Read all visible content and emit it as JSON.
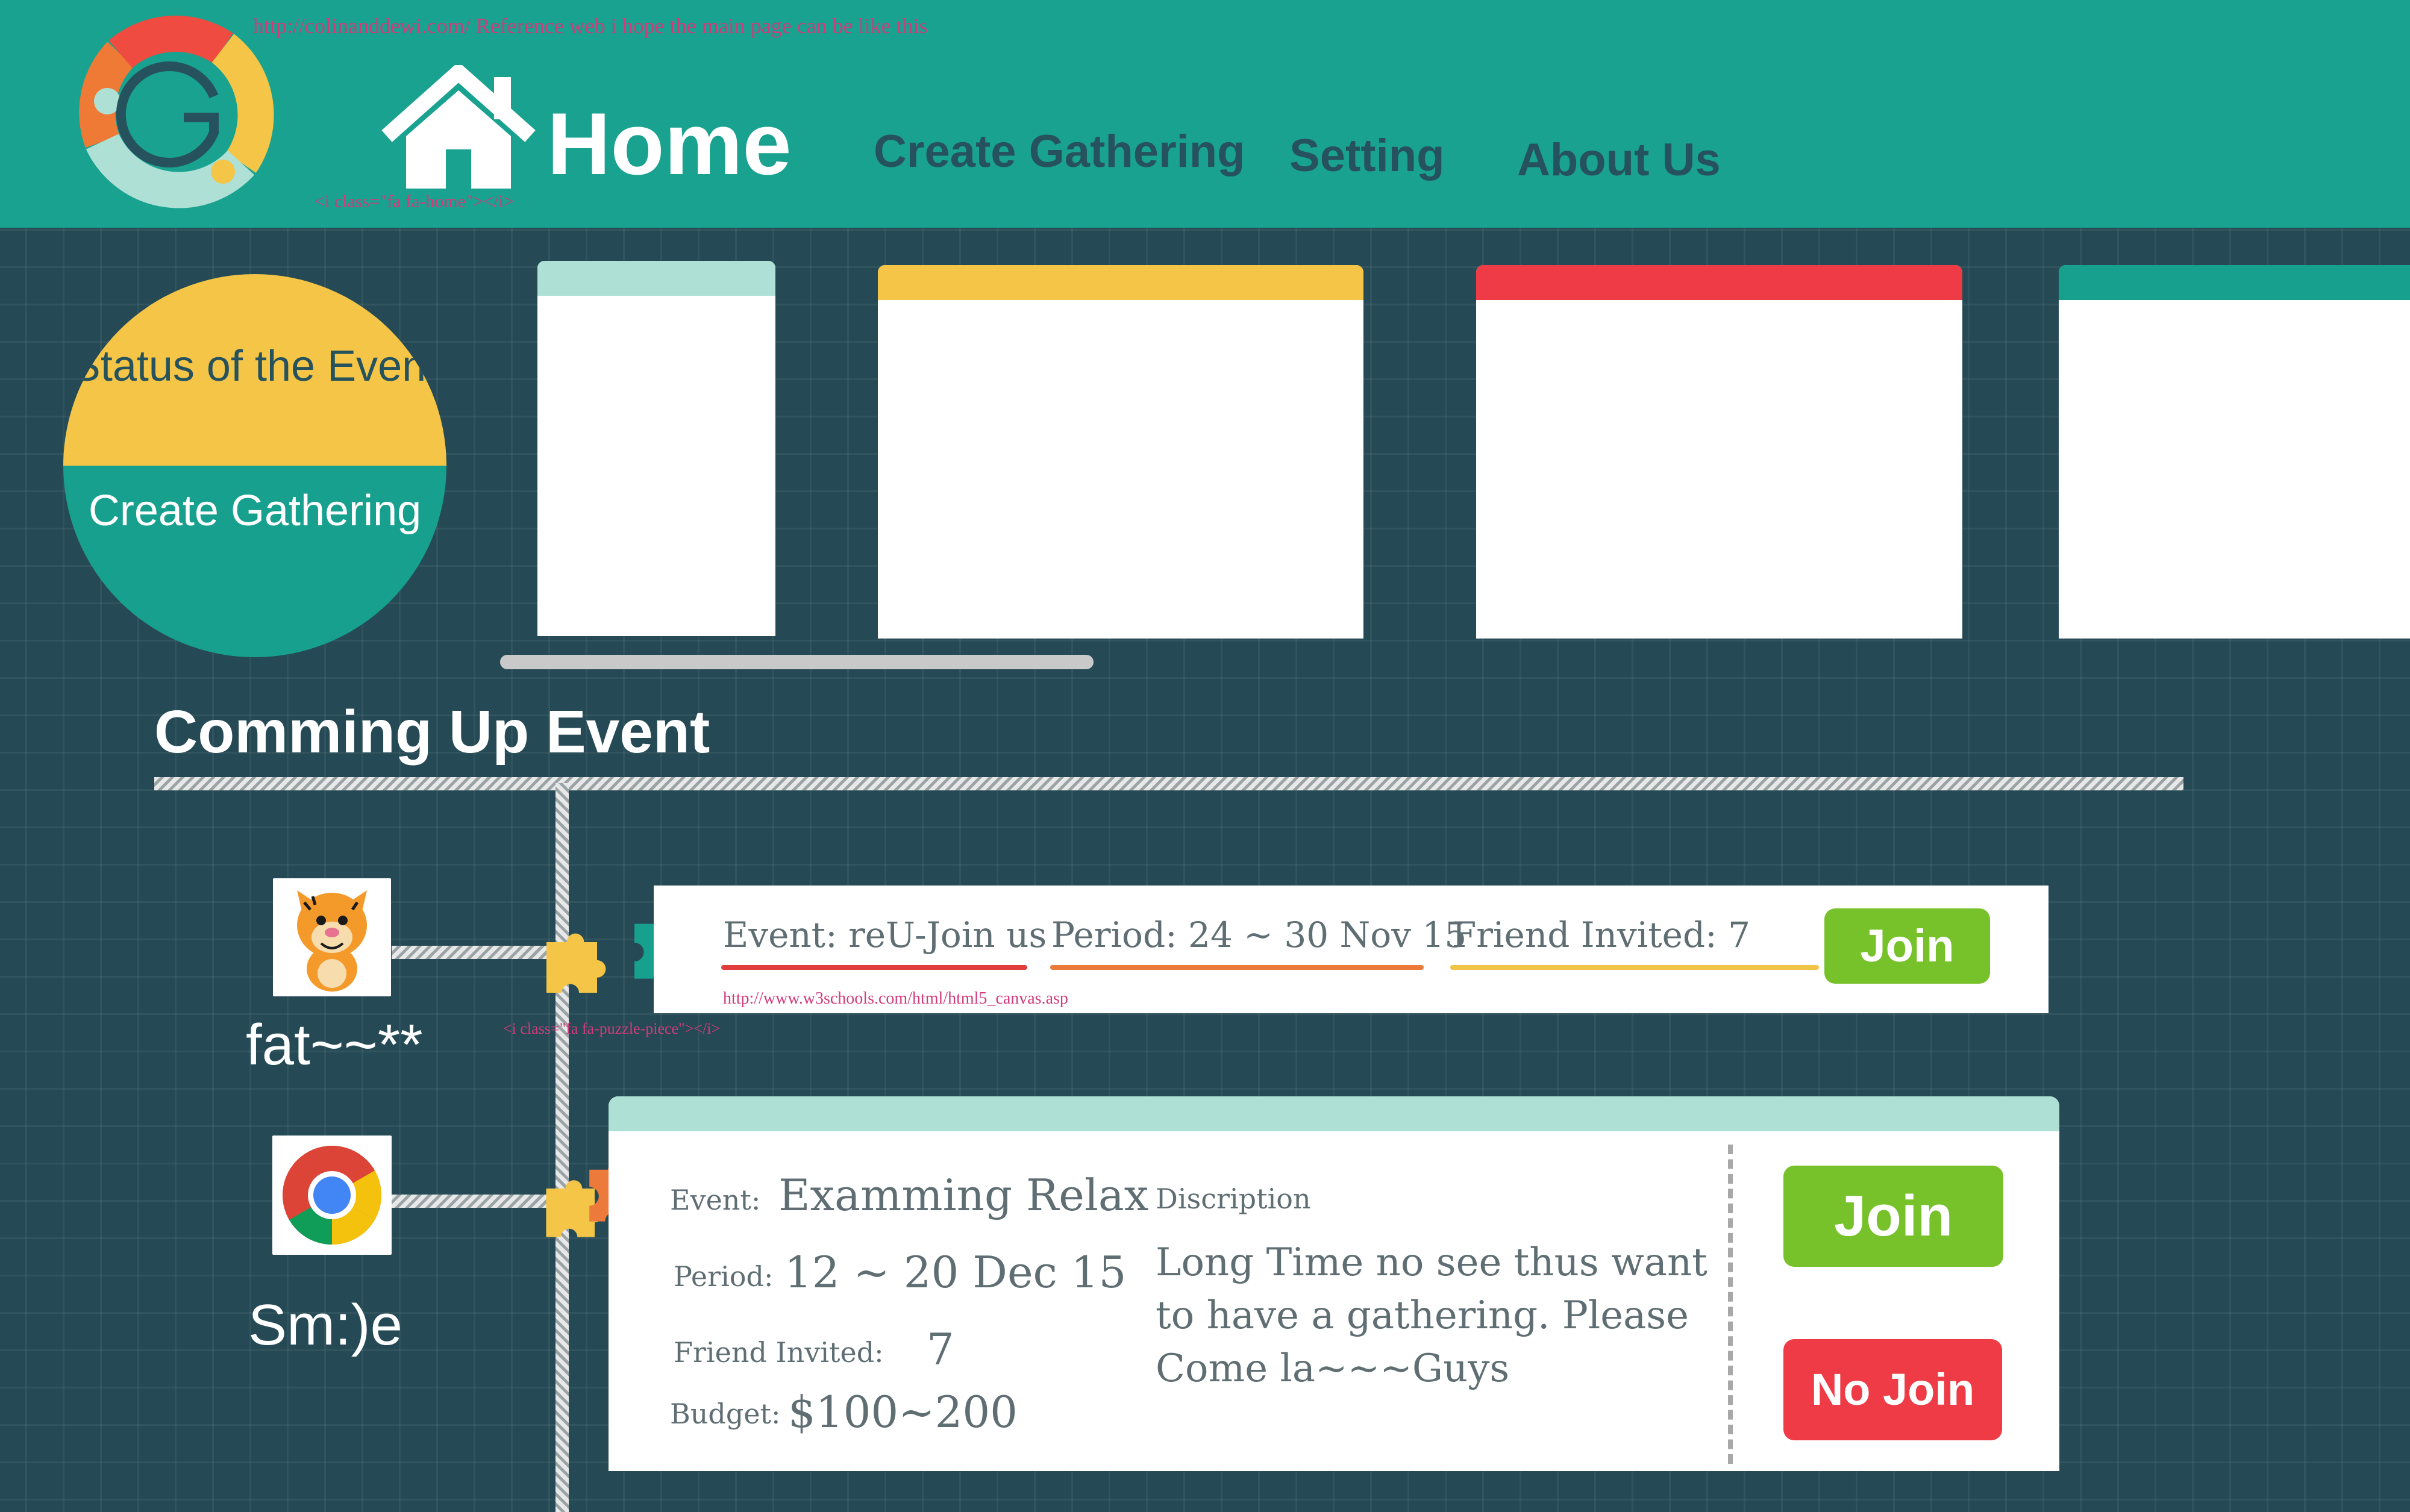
{
  "header": {
    "reference_note": "http://colinanddewi.com/   Reference web i hope the main page can be like this",
    "home_code_note": "<i class=\"fa fa-home\"></i>",
    "home_label": "Home",
    "nav": {
      "create": "Create Gathering",
      "setting": "Setting",
      "about": "About Us"
    }
  },
  "circle_menu": {
    "status_label": "Status of the Event",
    "create_label": "Create Gathering"
  },
  "colors": {
    "header": "#19a290",
    "background": "#254a55",
    "yellow": "#f4c546",
    "teal": "#18a08f",
    "red": "#ee3b45",
    "green": "#77c22b",
    "mint": "#aee0d6",
    "orange": "#ec7a3b"
  },
  "cards": [
    {
      "color": "#aee0d6"
    },
    {
      "color": "#f4c546"
    },
    {
      "color": "#ee3b45"
    },
    {
      "color": "#18a08f"
    }
  ],
  "section_title": "Comming Up Event",
  "events": [
    {
      "user": "fat~~**",
      "avatar_icon": "tigger-avatar-icon",
      "event_text": "Event: reU-Join us",
      "period_text": "Period: 24 ~ 30 Nov 15",
      "invited_text": "Friend Invited: 7",
      "url_note": "http://www.w3schools.com/html/html5_canvas.asp",
      "puzzle_code_note": "<i class=\"fa fa-puzzle-piece\"></i>",
      "join_label": "Join"
    },
    {
      "user": "Sm:)e",
      "avatar_icon": "chrome-avatar-icon",
      "labels": {
        "event": "Event:",
        "period": "Period:",
        "invited": "Friend Invited:",
        "budget": "Budget:",
        "description": "Discription"
      },
      "event_name": "Examming Relax",
      "period": "12 ~ 20 Dec 15",
      "invited": "7",
      "budget": "$100~200",
      "description": "Long Time no see thus want to  have a gathering. Please Come la~~~Guys",
      "join_label": "Join",
      "no_join_label": "No Join"
    }
  ]
}
